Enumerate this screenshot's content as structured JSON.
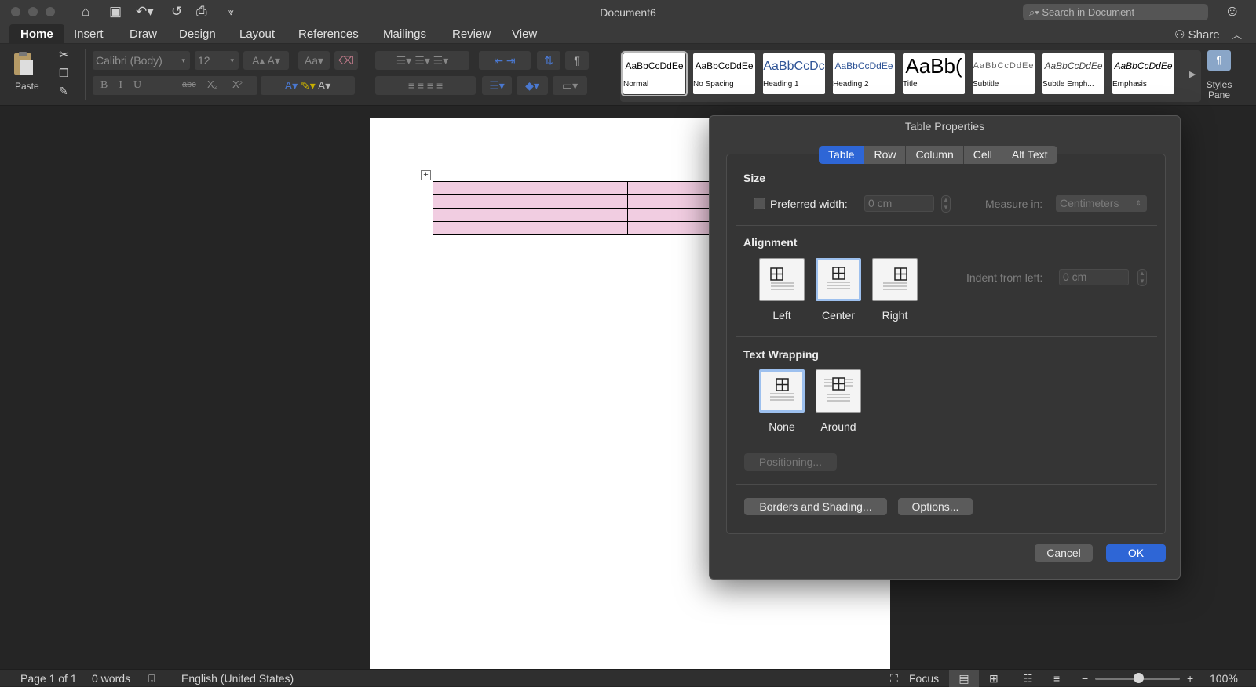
{
  "window": {
    "title": "Document6",
    "search_placeholder": "Search in Document"
  },
  "ribbon_tabs": [
    "Home",
    "Insert",
    "Draw",
    "Design",
    "Layout",
    "References",
    "Mailings",
    "Review",
    "View"
  ],
  "share_label": "Share",
  "ribbon": {
    "paste_label": "Paste",
    "font_name": "Calibri (Body)",
    "font_size": "12",
    "styles": [
      {
        "preview": "AaBbCcDdEe",
        "label": "Normal"
      },
      {
        "preview": "AaBbCcDdEe",
        "label": "No Spacing"
      },
      {
        "preview": "AaBbCcDc",
        "label": "Heading 1"
      },
      {
        "preview": "AaBbCcDdEe",
        "label": "Heading 2"
      },
      {
        "preview": "AaBb(",
        "label": "Title"
      },
      {
        "preview": "AaBbCcDdEe",
        "label": "Subtitle"
      },
      {
        "preview": "AaBbCcDdEe",
        "label": "Subtle Emph..."
      },
      {
        "preview": "AaBbCcDdEe",
        "label": "Emphasis"
      }
    ],
    "styles_pane_label_1": "Styles",
    "styles_pane_label_2": "Pane"
  },
  "dialog": {
    "title": "Table Properties",
    "tabs": [
      "Table",
      "Row",
      "Column",
      "Cell",
      "Alt Text"
    ],
    "active_tab": "Table",
    "size": {
      "heading": "Size",
      "preferred_width_label": "Preferred width:",
      "preferred_width_value": "0 cm",
      "preferred_width_checked": false,
      "measure_in_label": "Measure in:",
      "measure_in_value": "Centimeters"
    },
    "alignment": {
      "heading": "Alignment",
      "options": [
        "Left",
        "Center",
        "Right"
      ],
      "selected": "Center",
      "indent_label": "Indent from left:",
      "indent_value": "0 cm"
    },
    "text_wrapping": {
      "heading": "Text Wrapping",
      "options": [
        "None",
        "Around"
      ],
      "selected": "None",
      "positioning_label": "Positioning..."
    },
    "borders_label": "Borders and Shading...",
    "options_label": "Options...",
    "cancel_label": "Cancel",
    "ok_label": "OK"
  },
  "document": {
    "table_rows": 4,
    "table_cols": 2,
    "cell_color": "#f1cde1"
  },
  "status": {
    "page": "Page 1 of 1",
    "words": "0 words",
    "language": "English (United States)",
    "focus_label": "Focus",
    "zoom": "100%"
  },
  "colors": {
    "accent": "#2e66d6",
    "dialog_bg": "#3a3a3a",
    "app_bg": "#252525"
  }
}
